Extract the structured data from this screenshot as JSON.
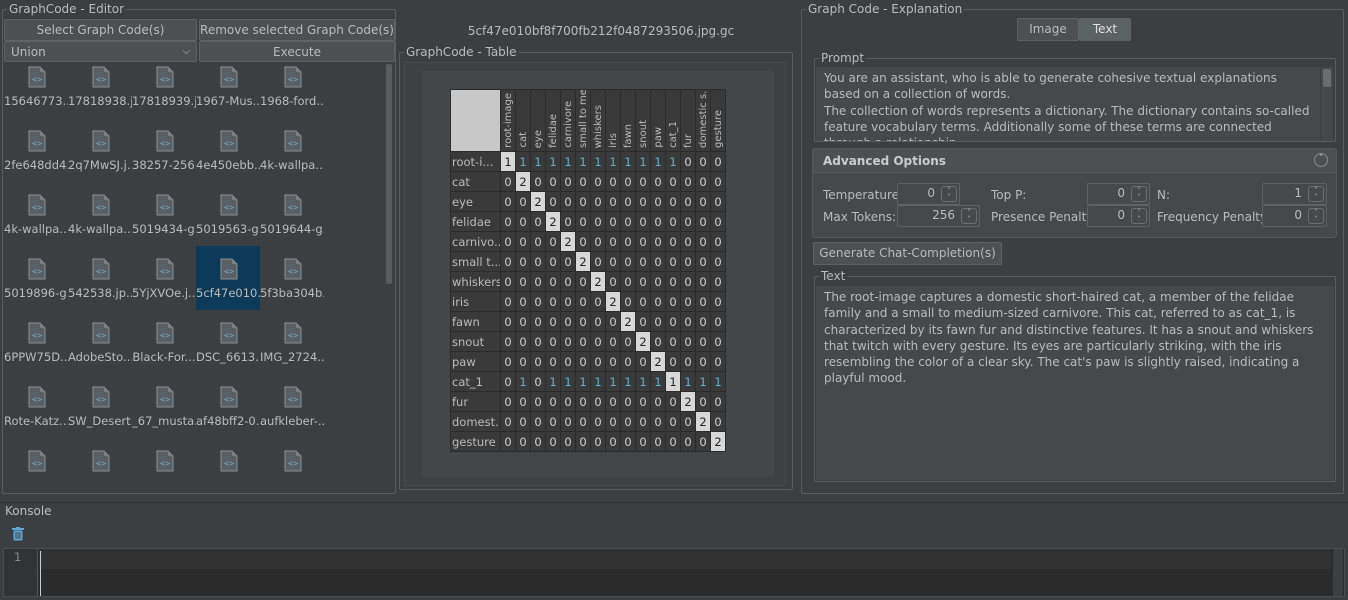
{
  "editor": {
    "title": "GraphCode - Editor",
    "select_button": "Select Graph Code(s)",
    "remove_button": "Remove selected Graph Code(s)",
    "combo_value": "Union",
    "execute_button": "Execute",
    "files": [
      "15646773...",
      "17818938.j...",
      "17818939.j...",
      "1967-Mus...",
      "1968-ford...",
      "2fe648dd4...",
      "2q7MwSJ.j...",
      "38257-256...",
      "4e450ebb...",
      "4k-wallpa...",
      "4k-wallpa...",
      "4k-wallpa...",
      "5019434-g...",
      "5019563-g...",
      "5019644-g...",
      "5019896-g...",
      "542538.jp...",
      "5YjXVOe.j...",
      "5cf47e010...",
      "5f3ba304b...",
      "6PPW75D...",
      "AdobeSto...",
      "Black-For...",
      "DSC_6613...",
      "IMG_2724...",
      "Rote-Katz...",
      "SW_Desert...",
      "_67_musta...",
      "af48bff2-0...",
      "aufkleber-...",
      "",
      "",
      "",
      "",
      ""
    ],
    "selected_index": 18
  },
  "center": {
    "file_title": "5cf47e010bf8f700fb212f0487293506.jpg.gc",
    "table_title": "GraphCode - Table",
    "columns": [
      "root-image",
      "cat",
      "eye",
      "felidae",
      "carnivore",
      "small to me...",
      "whiskers",
      "iris",
      "fawn",
      "snout",
      "paw",
      "cat_1",
      "fur",
      "domestic s...",
      "gesture"
    ],
    "rows": [
      {
        "label": "root-i...",
        "values": [
          "1",
          "1",
          "1",
          "1",
          "1",
          "1",
          "1",
          "1",
          "1",
          "1",
          "1",
          "1",
          "0",
          "0",
          "0"
        ]
      },
      {
        "label": "cat",
        "values": [
          "0",
          "2",
          "0",
          "0",
          "0",
          "0",
          "0",
          "0",
          "0",
          "0",
          "0",
          "0",
          "0",
          "0",
          "0"
        ]
      },
      {
        "label": "eye",
        "values": [
          "0",
          "0",
          "2",
          "0",
          "0",
          "0",
          "0",
          "0",
          "0",
          "0",
          "0",
          "0",
          "0",
          "0",
          "0"
        ]
      },
      {
        "label": "felidae",
        "values": [
          "0",
          "0",
          "0",
          "2",
          "0",
          "0",
          "0",
          "0",
          "0",
          "0",
          "0",
          "0",
          "0",
          "0",
          "0"
        ]
      },
      {
        "label": "carnivo...",
        "values": [
          "0",
          "0",
          "0",
          "0",
          "2",
          "0",
          "0",
          "0",
          "0",
          "0",
          "0",
          "0",
          "0",
          "0",
          "0"
        ]
      },
      {
        "label": "small t...",
        "values": [
          "0",
          "0",
          "0",
          "0",
          "0",
          "2",
          "0",
          "0",
          "0",
          "0",
          "0",
          "0",
          "0",
          "0",
          "0"
        ]
      },
      {
        "label": "whiskers",
        "values": [
          "0",
          "0",
          "0",
          "0",
          "0",
          "0",
          "2",
          "0",
          "0",
          "0",
          "0",
          "0",
          "0",
          "0",
          "0"
        ]
      },
      {
        "label": "iris",
        "values": [
          "0",
          "0",
          "0",
          "0",
          "0",
          "0",
          "0",
          "2",
          "0",
          "0",
          "0",
          "0",
          "0",
          "0",
          "0"
        ]
      },
      {
        "label": "fawn",
        "values": [
          "0",
          "0",
          "0",
          "0",
          "0",
          "0",
          "0",
          "0",
          "2",
          "0",
          "0",
          "0",
          "0",
          "0",
          "0"
        ]
      },
      {
        "label": "snout",
        "values": [
          "0",
          "0",
          "0",
          "0",
          "0",
          "0",
          "0",
          "0",
          "0",
          "2",
          "0",
          "0",
          "0",
          "0",
          "0"
        ]
      },
      {
        "label": "paw",
        "values": [
          "0",
          "0",
          "0",
          "0",
          "0",
          "0",
          "0",
          "0",
          "0",
          "0",
          "2",
          "0",
          "0",
          "0",
          "0"
        ]
      },
      {
        "label": "cat_1",
        "values": [
          "0",
          "1",
          "0",
          "1",
          "1",
          "1",
          "1",
          "1",
          "1",
          "1",
          "1",
          "1",
          "1",
          "1",
          "1"
        ]
      },
      {
        "label": "fur",
        "values": [
          "0",
          "0",
          "0",
          "0",
          "0",
          "0",
          "0",
          "0",
          "0",
          "0",
          "0",
          "0",
          "2",
          "0",
          "0"
        ]
      },
      {
        "label": "domest...",
        "values": [
          "0",
          "0",
          "0",
          "0",
          "0",
          "0",
          "0",
          "0",
          "0",
          "0",
          "0",
          "0",
          "0",
          "2",
          "0"
        ]
      },
      {
        "label": "gesture",
        "values": [
          "0",
          "0",
          "0",
          "0",
          "0",
          "0",
          "0",
          "0",
          "0",
          "0",
          "0",
          "0",
          "0",
          "0",
          "2"
        ]
      }
    ]
  },
  "explanation": {
    "title": "Graph Code - Explanation",
    "tab_image": "Image",
    "tab_text": "Text",
    "active_tab": "Text",
    "prompt_label": "Prompt",
    "prompt_text": "You are an assistant, who is able to generate cohesive textual explanations based on a collection of words.\nThe collection of words represents a dictionary. The dictionary contains so-called feature vocabulary terms. Additionally some of these terms are connected through a relationship.\nThe relationships will be given to you in the form of a matrix, where the rows and columns of",
    "advanced_title": "Advanced Options",
    "temperature_label": "Temperature:",
    "temperature": "0",
    "top_p_label": "Top P:",
    "top_p": "0",
    "n_label": "N:",
    "n": "1",
    "max_tokens_label": "Max Tokens:",
    "max_tokens": "256",
    "presence_label": "Presence Penalty:",
    "presence": "0",
    "frequency_label": "Frequency Penalty:",
    "frequency": "0",
    "generate_button": "Generate Chat-Completion(s)",
    "text_label": "Text",
    "output_text": "The root-image captures a domestic short-haired cat, a member of the felidae family and a small to medium-sized carnivore. This cat, referred to as cat_1, is characterized by its fawn fur and distinctive features. It has a snout and whiskers that twitch with every gesture. Its eyes are particularly striking, with the iris resembling the color of a clear sky. The cat's paw is slightly raised, indicating a playful mood."
  },
  "console": {
    "title": "Konsole",
    "line_number": "1"
  },
  "colors": {
    "background": "#3c3f41",
    "selected": "#0d3a58",
    "accent_one": "#5fb0d0",
    "diagonal": "#d8d8d8"
  }
}
